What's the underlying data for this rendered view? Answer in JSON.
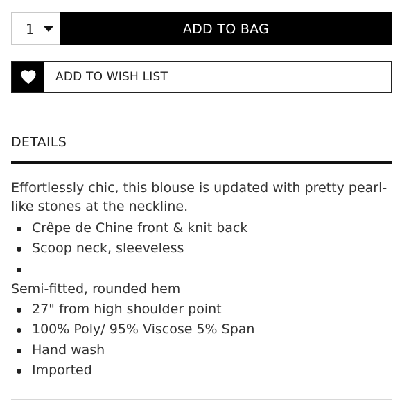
{
  "purchase": {
    "quantity": "1",
    "add_to_bag_label": "ADD TO BAG",
    "add_to_wish_list_label": "ADD TO WISH LIST"
  },
  "details": {
    "heading": "DETAILS",
    "description": "Effortlessly chic, this blouse is updated with pretty pearl-like stones at the neckline.",
    "items": [
      "Crêpe de Chine front & knit back",
      "Scoop neck, sleeveless",
      "",
      "Semi-fitted, rounded hem",
      "27\" from high shoulder point",
      "100% Poly/ 95% Viscose 5% Span",
      "Hand wash",
      "Imported"
    ]
  },
  "icons": {
    "wish_list": "heart-icon",
    "quantity_dropdown": "caret-down-icon"
  },
  "colors": {
    "primary_button": "#000000",
    "text": "#333333",
    "border": "#222222"
  }
}
